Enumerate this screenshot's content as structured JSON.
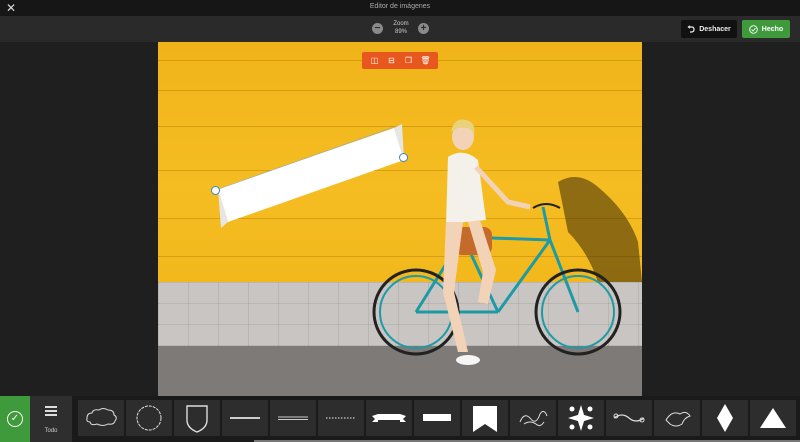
{
  "window": {
    "title": "Editor de imágenes",
    "close_icon": "close-icon"
  },
  "zoom": {
    "label": "Zoom",
    "value": "89%"
  },
  "actions": {
    "undo_label": "Deshacer",
    "done_label": "Hecho"
  },
  "floating_toolbar": {
    "icons": [
      "flip-horizontal-icon",
      "flip-vertical-icon",
      "duplicate-icon",
      "delete-icon"
    ]
  },
  "category": {
    "label": "Todo",
    "icon": "list-icon"
  },
  "shapes": [
    "cloud-shape",
    "badge-shape",
    "shield-shape",
    "line-shape",
    "double-line-shape",
    "dotted-line-shape",
    "ribbon-shape",
    "banner-shape",
    "bookmark-shape",
    "flourish-shape",
    "ornament-shape",
    "swirl-shape",
    "bird-ornament-shape",
    "diamond-shape",
    "triangle-shape"
  ],
  "colors": {
    "accent_green": "#3f9a3c",
    "toolbar_orange": "#e8571e",
    "wall_yellow": "#f5bd22"
  }
}
